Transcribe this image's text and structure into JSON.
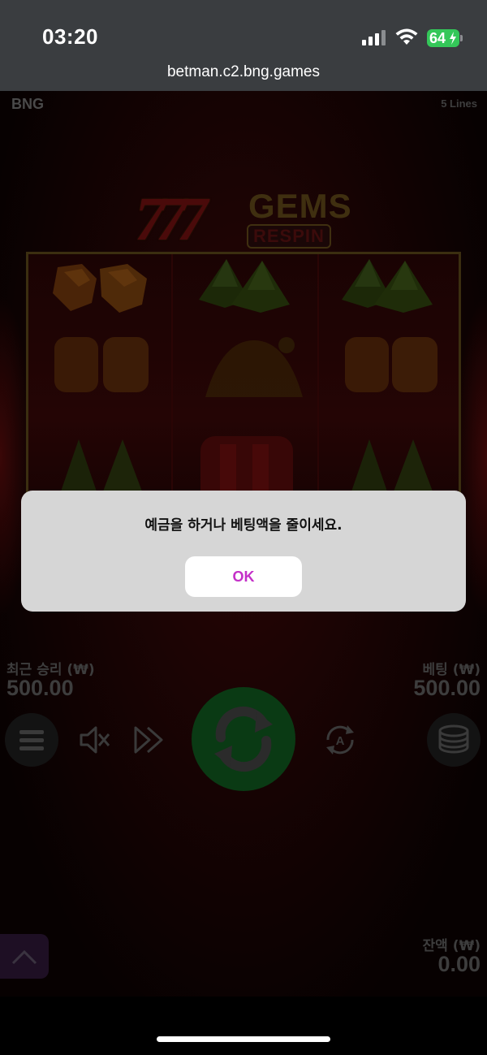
{
  "status_bar": {
    "time": "03:20",
    "battery": "64",
    "icons": [
      "signal-icon",
      "wifi-icon",
      "battery-charging-icon"
    ]
  },
  "browser": {
    "url": "betman.c2.bng.games"
  },
  "game": {
    "brand": "BNG",
    "lines": "5 Lines",
    "logo_sevens": "777",
    "logo_gems": "GEMS",
    "logo_respin": "RESPIN"
  },
  "dialog": {
    "message": "예금을 하거나 베팅액을 줄이세요.",
    "ok_label": "OK"
  },
  "hud": {
    "last_win_label": "최근 승리 (₩)",
    "last_win_value": "500.00",
    "bet_label": "베팅 (₩)",
    "bet_value": "500.00",
    "balance_label": "잔액 (₩)",
    "balance_value": "0.00"
  },
  "colors": {
    "ok_text": "#c42fc8",
    "spin_button": "#0a3a14",
    "battery": "#34c759"
  }
}
